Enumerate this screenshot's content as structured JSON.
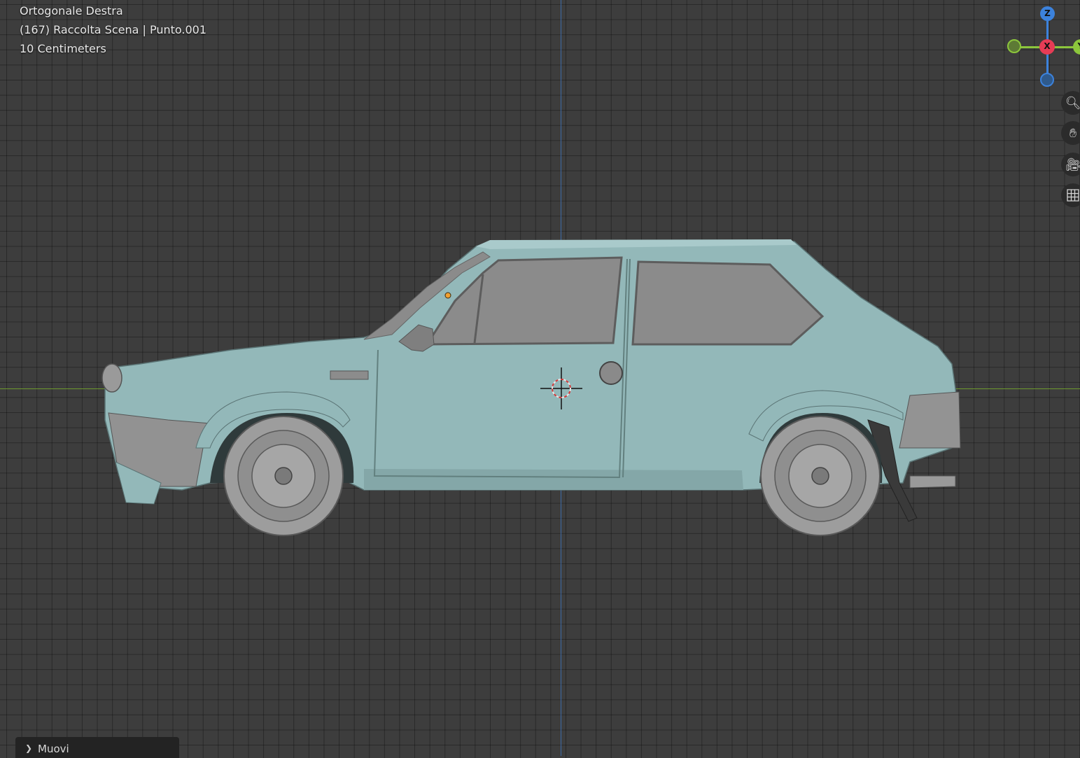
{
  "viewport": {
    "view_name": "Ortogonale Destra",
    "collection_line": "(167) Raccolta Scena | Punto.001",
    "unit_line": "10 Centimeters"
  },
  "gizmo": {
    "z_label": "Z",
    "x_label": "X",
    "y_label": "Y",
    "colors": {
      "x": "#e63c55",
      "y": "#8cc63c",
      "z": "#3c82dc"
    }
  },
  "nav_buttons": [
    "zoom-icon",
    "hand-pan-icon",
    "camera-icon",
    "grid-icon"
  ],
  "operator_panel": {
    "label": "Muovi"
  },
  "colors": {
    "background": "#3d3d3d",
    "car_body": "#93b8b9",
    "glass": "#8b8b8b",
    "trim": "#9c9c9c",
    "axis_x": "#6e9a2e",
    "axis_y": "#3e6aa6"
  }
}
